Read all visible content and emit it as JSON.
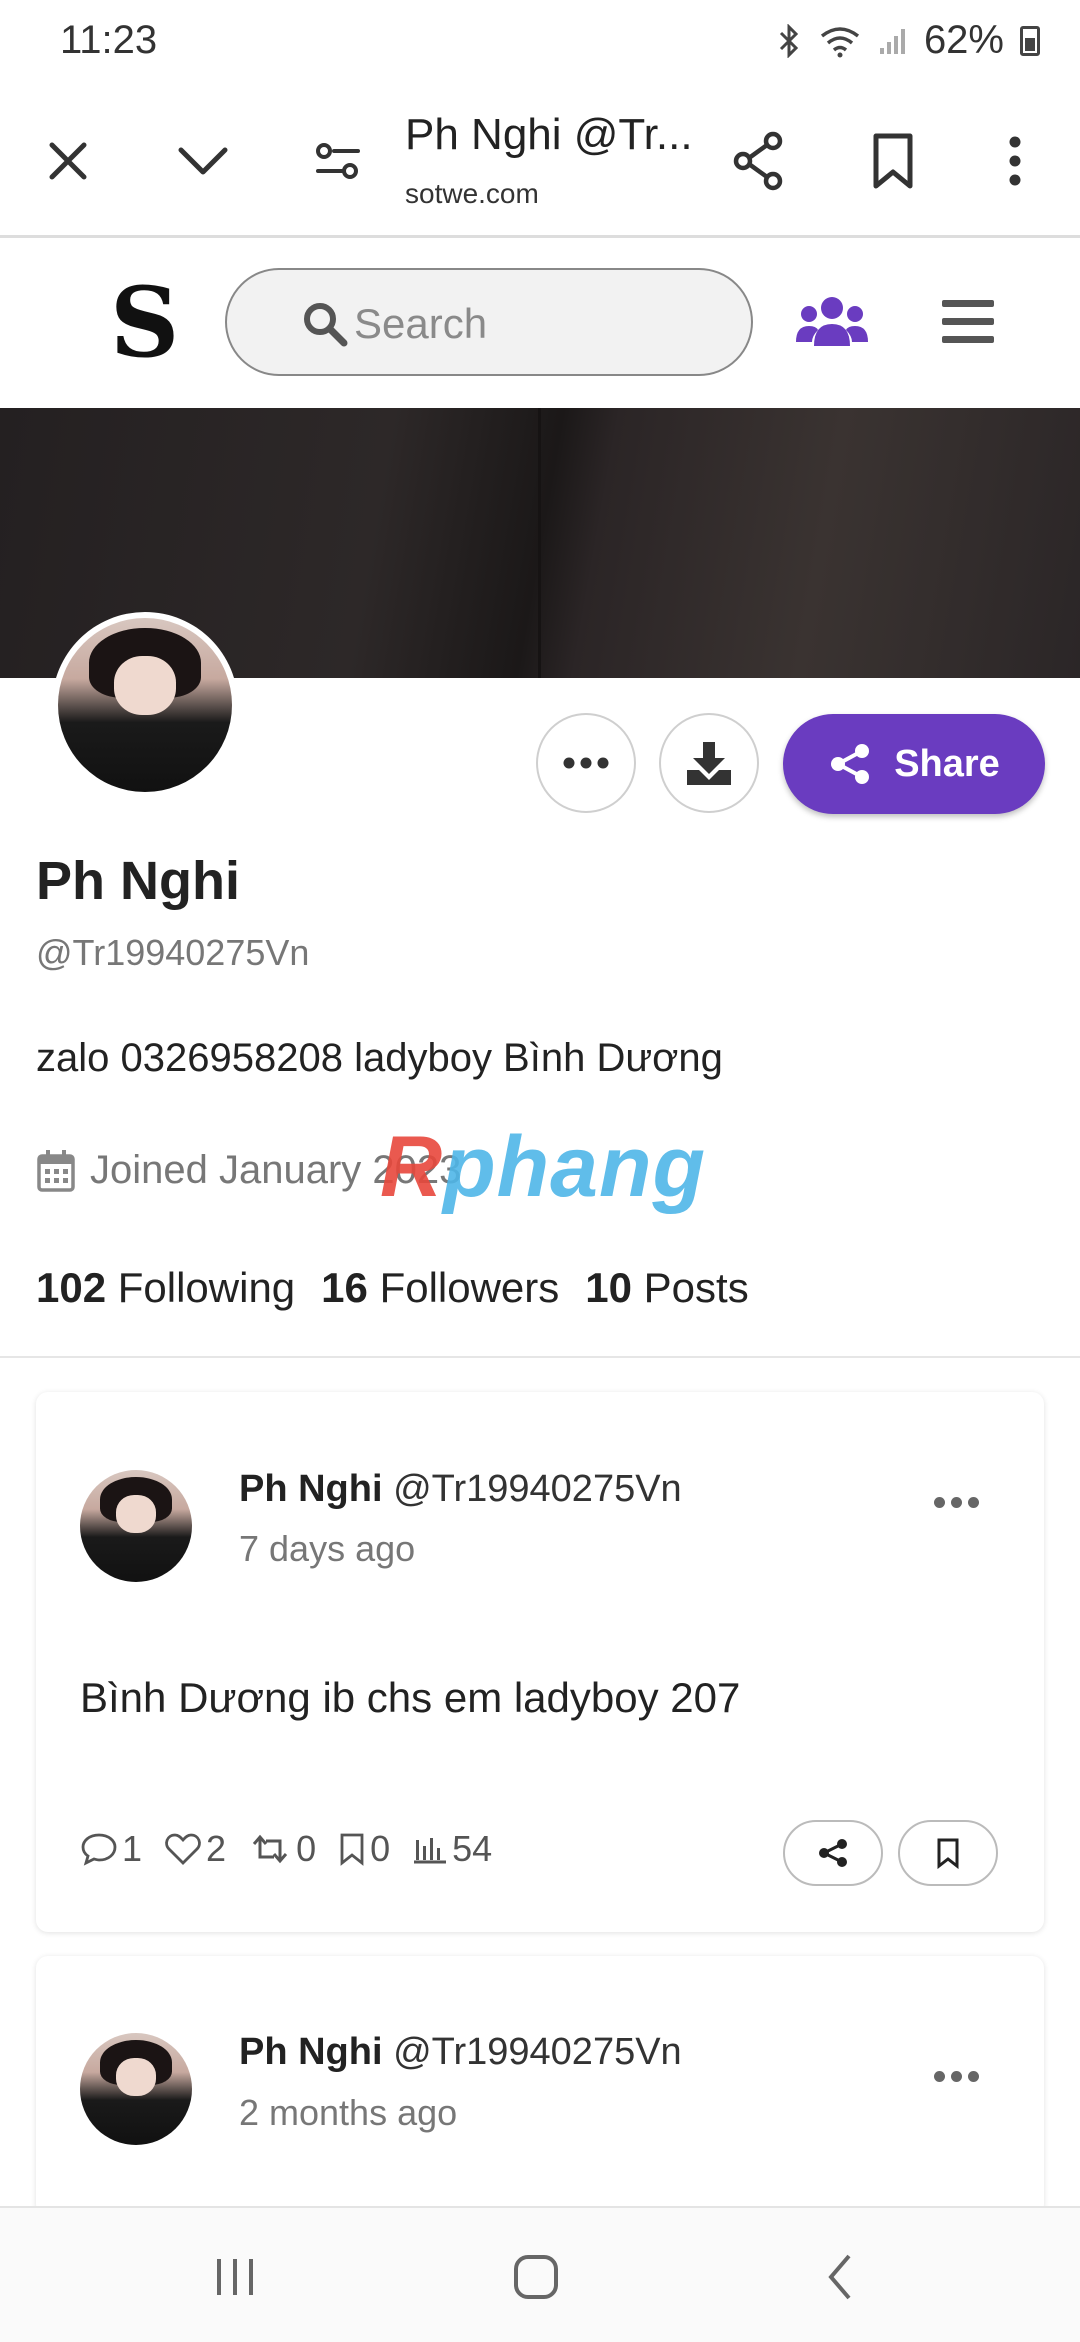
{
  "status_bar": {
    "time": "11:23",
    "battery": "62%"
  },
  "browser": {
    "title": "Ph Nghi @Tr...",
    "domain": "sotwe.com"
  },
  "site": {
    "logo": "S",
    "search_placeholder": "Search"
  },
  "profile": {
    "name": "Ph Nghi",
    "handle": "@Tr19940275Vn",
    "bio": "zalo 0326958208 ladyboy Bình Dương",
    "joined": "Joined January 2023",
    "share_label": "Share",
    "stats": {
      "following_count": "102",
      "following_label": "Following",
      "followers_count": "16",
      "followers_label": "Followers",
      "posts_count": "10",
      "posts_label": "Posts"
    }
  },
  "watermark": {
    "first": "R",
    "rest": "phang"
  },
  "posts": [
    {
      "author_name": "Ph Nghi",
      "author_handle": "@Tr19940275Vn",
      "time": "7 days ago",
      "text": "Bình Dương ib chs em ladyboy 207",
      "replies": "1",
      "likes": "2",
      "reposts": "0",
      "bookmarks": "0",
      "views": "54"
    },
    {
      "author_name": "Ph Nghi",
      "author_handle": "@Tr19940275Vn",
      "time": "2 months ago"
    }
  ],
  "colors": {
    "accent": "#6a3cc0",
    "text": "#222222",
    "muted": "#777777"
  }
}
